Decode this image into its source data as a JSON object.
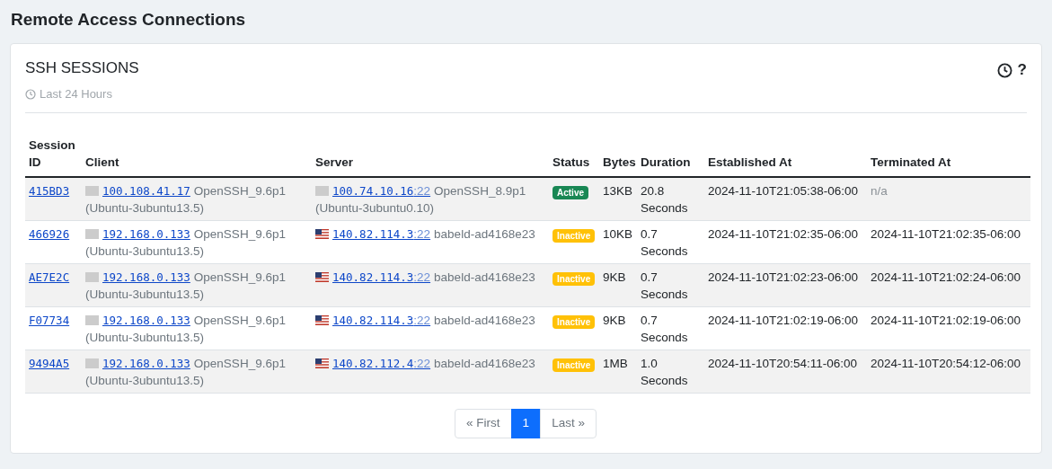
{
  "page_title": "Remote Access Connections",
  "card": {
    "title": "SSH SESSIONS",
    "subtitle": "Last 24 Hours",
    "help": "?"
  },
  "table": {
    "columns": [
      "Session ID",
      "Client",
      "Server",
      "Status",
      "Bytes",
      "Duration",
      "Established At",
      "Terminated At"
    ],
    "rows": [
      {
        "id": "415BD3",
        "client": {
          "flag": {
            "kind": "unknown"
          },
          "ip": "100.108.41.17",
          "software": "OpenSSH_9.6p1",
          "build": "(Ubuntu-3ubuntu13.5)"
        },
        "server": {
          "flag": {
            "kind": "unknown"
          },
          "ip": "100.74.10.16",
          "port": ":22",
          "software": "OpenSSH_8.9p1",
          "build": "(Ubuntu-3ubuntu0.10)"
        },
        "status": {
          "label": "Active",
          "kind": "active"
        },
        "bytes": "13KB",
        "duration": "20.8 Seconds",
        "established": "2024-11-10T21:05:38-06:00",
        "terminated": {
          "text": "n/a",
          "kind": "none"
        }
      },
      {
        "id": "466926",
        "client": {
          "flag": {
            "kind": "unknown"
          },
          "ip": "192.168.0.133",
          "software": "OpenSSH_9.6p1",
          "build": "(Ubuntu-3ubuntu13.5)"
        },
        "server": {
          "flag": {
            "kind": "us"
          },
          "ip": "140.82.114.3",
          "port": ":22",
          "software": "babeld-ad4168e23"
        },
        "status": {
          "label": "Inactive",
          "kind": "inactive"
        },
        "bytes": "10KB",
        "duration": "0.7 Seconds",
        "established": "2024-11-10T21:02:35-06:00",
        "terminated": {
          "text": "2024-11-10T21:02:35-06:00",
          "kind": "time"
        }
      },
      {
        "id": "AE7E2C",
        "client": {
          "flag": {
            "kind": "unknown"
          },
          "ip": "192.168.0.133",
          "software": "OpenSSH_9.6p1",
          "build": "(Ubuntu-3ubuntu13.5)"
        },
        "server": {
          "flag": {
            "kind": "us"
          },
          "ip": "140.82.114.3",
          "port": ":22",
          "software": "babeld-ad4168e23"
        },
        "status": {
          "label": "Inactive",
          "kind": "inactive"
        },
        "bytes": "9KB",
        "duration": "0.7 Seconds",
        "established": "2024-11-10T21:02:23-06:00",
        "terminated": {
          "text": "2024-11-10T21:02:24-06:00",
          "kind": "time"
        }
      },
      {
        "id": "F07734",
        "client": {
          "flag": {
            "kind": "unknown"
          },
          "ip": "192.168.0.133",
          "software": "OpenSSH_9.6p1",
          "build": "(Ubuntu-3ubuntu13.5)"
        },
        "server": {
          "flag": {
            "kind": "us"
          },
          "ip": "140.82.114.3",
          "port": ":22",
          "software": "babeld-ad4168e23"
        },
        "status": {
          "label": "Inactive",
          "kind": "inactive"
        },
        "bytes": "9KB",
        "duration": "0.7 Seconds",
        "established": "2024-11-10T21:02:19-06:00",
        "terminated": {
          "text": "2024-11-10T21:02:19-06:00",
          "kind": "time"
        }
      },
      {
        "id": "9494A5",
        "client": {
          "flag": {
            "kind": "unknown"
          },
          "ip": "192.168.0.133",
          "software": "OpenSSH_9.6p1",
          "build": "(Ubuntu-3ubuntu13.5)"
        },
        "server": {
          "flag": {
            "kind": "us"
          },
          "ip": "140.82.112.4",
          "port": ":22",
          "software": "babeld-ad4168e23"
        },
        "status": {
          "label": "Inactive",
          "kind": "inactive"
        },
        "bytes": "1MB",
        "duration": "1.0 Seconds",
        "established": "2024-11-10T20:54:11-06:00",
        "terminated": {
          "text": "2024-11-10T20:54:12-06:00",
          "kind": "time"
        }
      }
    ]
  },
  "pagination": [
    {
      "label": "« First",
      "selected": false
    },
    {
      "label": "1",
      "selected": true
    },
    {
      "label": "Last »",
      "selected": false
    }
  ]
}
